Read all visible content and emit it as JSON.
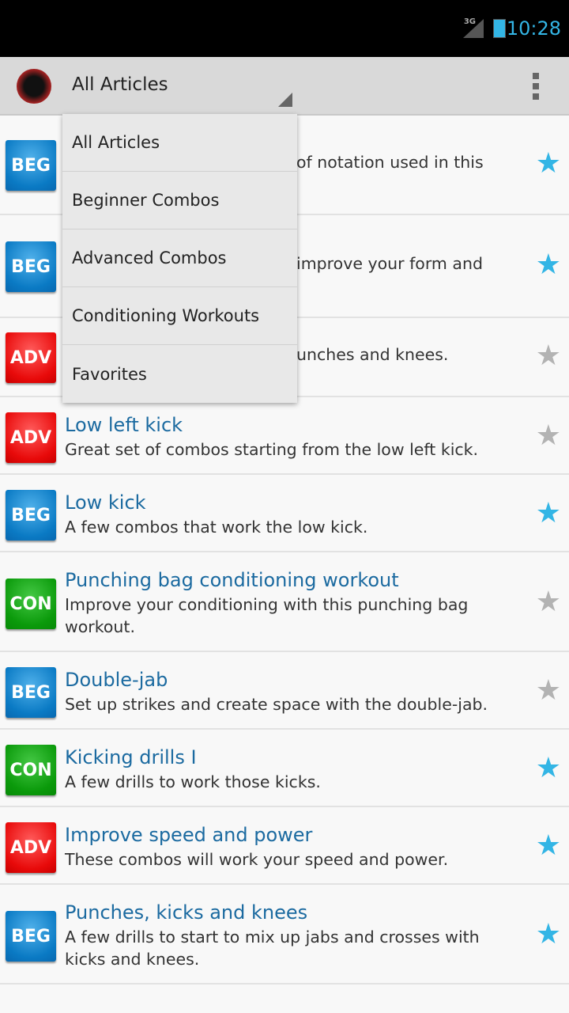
{
  "status": {
    "network": "3G",
    "time": "10:28"
  },
  "actionbar": {
    "selected": "All Articles"
  },
  "dropdown": [
    "All Articles",
    "Beginner Combos",
    "Advanced Combos",
    "Conditioning Workouts",
    "Favorites"
  ],
  "hidden_rows": [
    {
      "badge": "BEG",
      "fragment": "of notation used in this",
      "favorite": true
    },
    {
      "badge": "BEG",
      "fragment": "improve your form and",
      "favorite": true
    },
    {
      "badge": "ADV",
      "fragment": "unches and knees.",
      "favorite": false
    }
  ],
  "articles": [
    {
      "badge": "ADV",
      "title": "Low left kick",
      "desc": "Great set of combos starting from the low left kick.",
      "favorite": false
    },
    {
      "badge": "BEG",
      "title": "Low kick",
      "desc": "A few combos that work the low kick.",
      "favorite": true
    },
    {
      "badge": "CON",
      "title": "Punching bag conditioning workout",
      "desc": "Improve your conditioning with this punching bag workout.",
      "favorite": false
    },
    {
      "badge": "BEG",
      "title": "Double-jab",
      "desc": "Set up strikes and create space with the double-jab.",
      "favorite": false
    },
    {
      "badge": "CON",
      "title": "Kicking drills I",
      "desc": "A few drills to work those kicks.",
      "favorite": true
    },
    {
      "badge": "ADV",
      "title": "Improve speed and power",
      "desc": "These combos will work your speed and power.",
      "favorite": true
    },
    {
      "badge": "BEG",
      "title": "Punches, kicks and knees",
      "desc": "A few drills to start to mix up jabs and crosses with kicks and knees.",
      "favorite": true
    }
  ],
  "colors": {
    "accent": "#33b5e5",
    "title": "#1b6aa0",
    "BEG": "#0a7ac4",
    "ADV": "#e80a0a",
    "CON": "#0b9a0b"
  }
}
